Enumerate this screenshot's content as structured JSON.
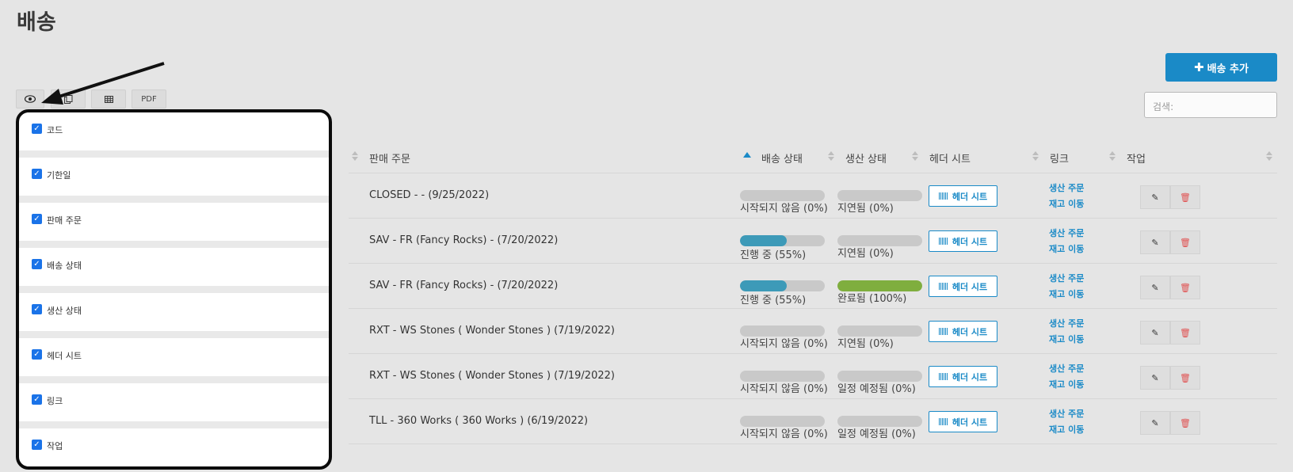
{
  "page": {
    "title": "배송"
  },
  "toolbar": {
    "add_label": "배송 추가",
    "search_placeholder": "검색:",
    "view_icon": "eye-icon",
    "copy_icon": "copy-icon",
    "table_icon": "table-icon",
    "pdf_label": "PDF"
  },
  "column_panel": {
    "items": [
      {
        "label": "코드",
        "checked": true
      },
      {
        "label": "기한일",
        "checked": true
      },
      {
        "label": "판매 주문",
        "checked": true
      },
      {
        "label": "배송 상태",
        "checked": true
      },
      {
        "label": "생산 상태",
        "checked": true
      },
      {
        "label": "헤더 시트",
        "checked": true
      },
      {
        "label": "링크",
        "checked": true
      },
      {
        "label": "작업",
        "checked": true
      }
    ]
  },
  "table": {
    "headers": {
      "sales_order": "판매 주문",
      "shipping_status": "배송 상태",
      "production_status": "생산 상태",
      "header_sheet": "헤더 시트",
      "link": "링크",
      "actions": "작업"
    },
    "rows": [
      {
        "sales_order": "CLOSED - - (9/25/2022)",
        "shipping": {
          "label": "시작되지 않음 (0%)",
          "percent": 0
        },
        "production": {
          "label": "지연됨 (0%)",
          "percent": 0
        },
        "header_sheet": "헤더 시트",
        "link_production": "생산 주문",
        "link_inventory": "재고 이동"
      },
      {
        "sales_order": "SAV - FR (Fancy Rocks) - (7/20/2022)",
        "shipping": {
          "label": "진행 중 (55%)",
          "percent": 55
        },
        "production": {
          "label": "지연됨 (0%)",
          "percent": 0
        },
        "header_sheet": "헤더 시트",
        "link_production": "생산 주문",
        "link_inventory": "재고 이동"
      },
      {
        "sales_order": "SAV - FR (Fancy Rocks) - (7/20/2022)",
        "shipping": {
          "label": "진행 중 (55%)",
          "percent": 55
        },
        "production": {
          "label": "완료됨 (100%)",
          "percent": 100
        },
        "header_sheet": "헤더 시트",
        "link_production": "생산 주문",
        "link_inventory": "재고 이동"
      },
      {
        "sales_order": "RXT - WS Stones ( Wonder Stones ) (7/19/2022)",
        "shipping": {
          "label": "시작되지 않음 (0%)",
          "percent": 0
        },
        "production": {
          "label": "지연됨 (0%)",
          "percent": 0
        },
        "header_sheet": "헤더 시트",
        "link_production": "생산 주문",
        "link_inventory": "재고 이동"
      },
      {
        "sales_order": "RXT - WS Stones ( Wonder Stones ) (7/19/2022)",
        "shipping": {
          "label": "시작되지 않음 (0%)",
          "percent": 0
        },
        "production": {
          "label": "일정 예정됨 (0%)",
          "percent": 0
        },
        "header_sheet": "헤더 시트",
        "link_production": "생산 주문",
        "link_inventory": "재고 이동"
      },
      {
        "sales_order": "TLL - 360 Works ( 360 Works ) (6/19/2022)",
        "shipping": {
          "label": "시작되지 않음 (0%)",
          "percent": 0
        },
        "production": {
          "label": "일정 예정됨 (0%)",
          "percent": 0
        },
        "header_sheet": "헤더 시트",
        "link_production": "생산 주문",
        "link_inventory": "재고 이동"
      }
    ]
  },
  "colors": {
    "accent": "#1a8ac7",
    "progress_blue": "#3d9ab8",
    "progress_green": "#7fae3e",
    "delete_red": "#e05252"
  }
}
